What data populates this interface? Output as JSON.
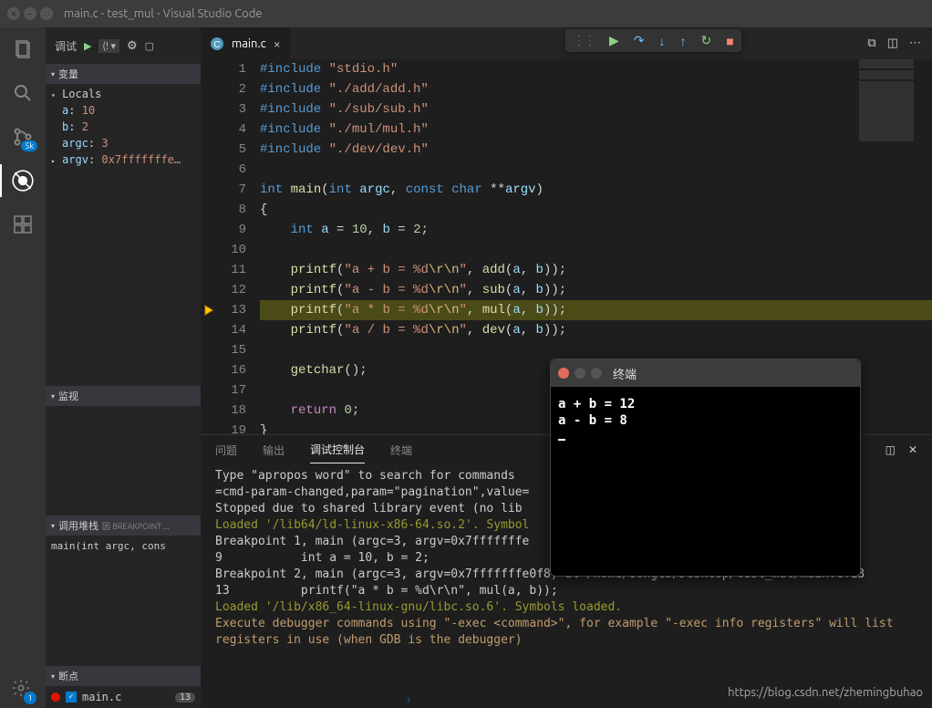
{
  "window": {
    "title": "main.c - test_mul - Visual Studio Code"
  },
  "sidebar": {
    "debug_label": "调试",
    "config": "(! ▾",
    "sections": {
      "variables": "变量",
      "locals": "Locals",
      "watch": "监视",
      "callstack": "调用堆栈",
      "callstack_badge": "因 BREAKPOINT ...",
      "breakpoints": "断点"
    },
    "vars": [
      {
        "name": "a",
        "value": "10"
      },
      {
        "name": "b",
        "value": "2"
      },
      {
        "name": "argc",
        "value": "3"
      },
      {
        "name": "argv",
        "value": "0x7fffffffe…"
      }
    ],
    "stack": "main(int argc, cons",
    "bp": {
      "file": "main.c",
      "count": "13"
    }
  },
  "tab": {
    "name": "main.c"
  },
  "debug_toolbar": {},
  "code": {
    "lines": [
      {
        "n": "1",
        "html": "<span class='pp2'>#include</span> <span class='str'>\"stdio.h\"</span>"
      },
      {
        "n": "2",
        "html": "<span class='pp2'>#include</span> <span class='str'>\"./add/add.h\"</span>"
      },
      {
        "n": "3",
        "html": "<span class='pp2'>#include</span> <span class='str'>\"./sub/sub.h\"</span>"
      },
      {
        "n": "4",
        "html": "<span class='pp2'>#include</span> <span class='str'>\"./mul/mul.h\"</span>"
      },
      {
        "n": "5",
        "html": "<span class='pp2'>#include</span> <span class='str'>\"./dev/dev.h\"</span>"
      },
      {
        "n": "6",
        "html": ""
      },
      {
        "n": "7",
        "html": "<span class='typ'>int</span> <span class='fn'>main</span><span class='pun'>(</span><span class='typ'>int</span> <span class='id'>argc</span><span class='pun'>,</span> <span class='typ'>const</span> <span class='typ'>char</span> <span class='pun'>**</span><span class='id'>argv</span><span class='pun'>)</span>"
      },
      {
        "n": "8",
        "html": "<span class='pun'>{</span>"
      },
      {
        "n": "9",
        "html": "    <span class='typ'>int</span> <span class='id'>a</span> <span class='pun'>=</span> <span class='num'>10</span><span class='pun'>,</span> <span class='id'>b</span> <span class='pun'>=</span> <span class='num'>2</span><span class='pun'>;</span>"
      },
      {
        "n": "10",
        "html": ""
      },
      {
        "n": "11",
        "html": "    <span class='fn'>printf</span><span class='pun'>(</span><span class='str'>\"a + b = %d</span><span class='esc'>\\r\\n</span><span class='str'>\"</span><span class='pun'>,</span> <span class='fn'>add</span><span class='pun'>(</span><span class='id'>a</span><span class='pun'>,</span> <span class='id'>b</span><span class='pun'>));</span>"
      },
      {
        "n": "12",
        "html": "    <span class='fn'>printf</span><span class='pun'>(</span><span class='str'>\"a - b = %d</span><span class='esc'>\\r\\n</span><span class='str'>\"</span><span class='pun'>,</span> <span class='fn'>sub</span><span class='pun'>(</span><span class='id'>a</span><span class='pun'>,</span> <span class='id'>b</span><span class='pun'>));</span>"
      },
      {
        "n": "13",
        "html": "    <span class='fn'>printf</span><span class='pun'>(</span><span class='str'>\"a * b = %d</span><span class='esc'>\\r\\n</span><span class='str'>\"</span><span class='pun'>,</span> <span class='fn'>mul</span><span class='pun'>(</span><span class='id'>a</span><span class='pun'>,</span> <span class='id'>b</span><span class='pun'>));</span>",
        "hl": true,
        "bp": true
      },
      {
        "n": "14",
        "html": "    <span class='fn'>printf</span><span class='pun'>(</span><span class='str'>\"a / b = %d</span><span class='esc'>\\r\\n</span><span class='str'>\"</span><span class='pun'>,</span> <span class='fn'>dev</span><span class='pun'>(</span><span class='id'>a</span><span class='pun'>,</span> <span class='id'>b</span><span class='pun'>));</span>"
      },
      {
        "n": "15",
        "html": ""
      },
      {
        "n": "16",
        "html": "    <span class='fn'>getchar</span><span class='pun'>();</span>"
      },
      {
        "n": "17",
        "html": ""
      },
      {
        "n": "18",
        "html": "    <span class='pp'>return</span> <span class='num'>0</span><span class='pun'>;</span>"
      },
      {
        "n": "19",
        "html": "<span class='pun'>}</span>"
      }
    ]
  },
  "panel": {
    "tabs": {
      "problems": "问题",
      "output": "输出",
      "debug_console": "调试控制台",
      "terminal": "终端"
    },
    "console_lines": [
      {
        "cls": "",
        "txt": "Type \"apropos word\" to search for commands "
      },
      {
        "cls": "",
        "txt": "=cmd-param-changed,param=\"pagination\",value="
      },
      {
        "cls": "",
        "txt": "Stopped due to shared library event (no lib"
      },
      {
        "cls": "y",
        "txt": "Loaded '/lib64/ld-linux-x86-64.so.2'. Symbol"
      },
      {
        "cls": "",
        "txt": ""
      },
      {
        "cls": "",
        "txt": "Breakpoint 1, main (argc=3, argv=0x7fffffffe                                      in.c:9"
      },
      {
        "cls": "",
        "txt": "9           int a = 10, b = 2;"
      },
      {
        "cls": "",
        "txt": ""
      },
      {
        "cls": "",
        "txt": "Breakpoint 2, main (argc=3, argv=0x7fffffffe0f8) at /home/songtb/Desktop/test_mul/main.c:13"
      },
      {
        "cls": "",
        "txt": "13          printf(\"a * b = %d\\r\\n\", mul(a, b));"
      },
      {
        "cls": "y",
        "txt": "Loaded '/lib/x86_64-linux-gnu/libc.so.6'. Symbols loaded."
      },
      {
        "cls": "o",
        "txt": "Execute debugger commands using \"-exec <command>\", for example \"-exec info registers\" will list registers in use (when GDB is the debugger)"
      }
    ]
  },
  "terminal": {
    "title": "终端",
    "lines": [
      "a + b = 12",
      "a - b = 8"
    ]
  },
  "watermark": "https://blog.csdn.net/zhemingbuhao",
  "activity_badge": "5k",
  "settings_badge": "1"
}
